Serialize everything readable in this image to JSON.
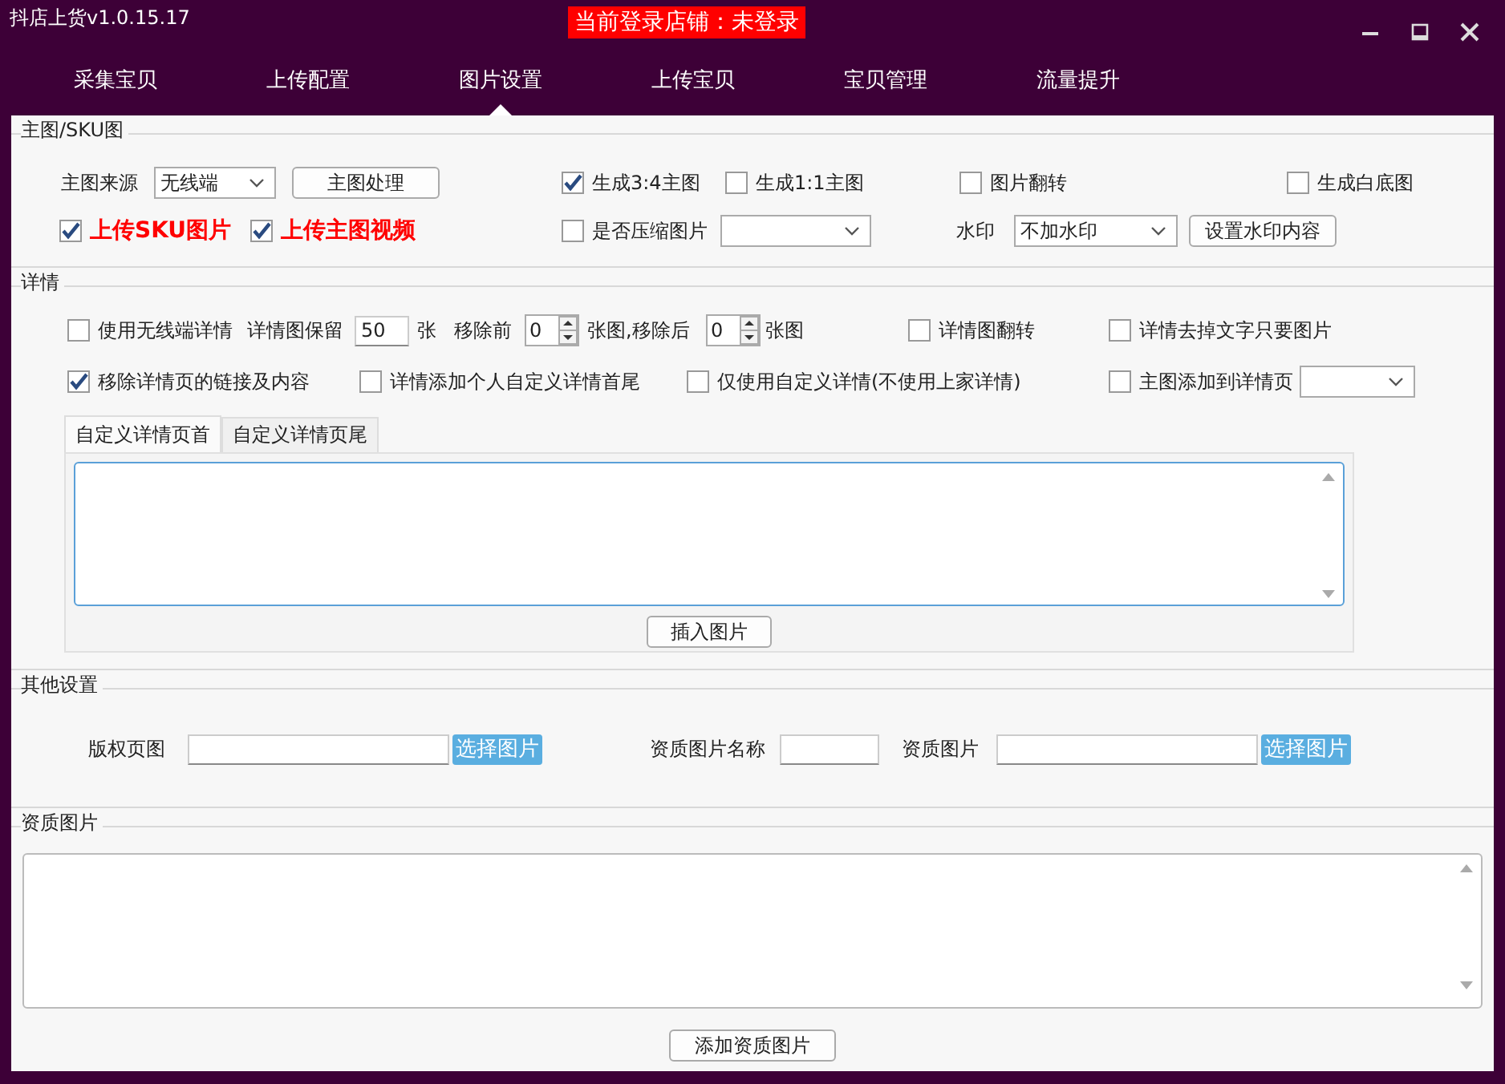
{
  "window": {
    "title": "抖店上货v1.0.15.17",
    "login_status": "当前登录店铺：未登录"
  },
  "tabs": [
    {
      "label": "采集宝贝",
      "selected": false
    },
    {
      "label": "上传配置",
      "selected": false
    },
    {
      "label": "图片设置",
      "selected": true
    },
    {
      "label": "上传宝贝",
      "selected": false
    },
    {
      "label": "宝贝管理",
      "selected": false
    },
    {
      "label": "流量提升",
      "selected": false
    }
  ],
  "main_image": {
    "title": "主图/SKU图",
    "source_label": "主图来源",
    "source_value": "无线端",
    "process_button": "主图处理",
    "gen_3_4": {
      "label": "生成3:4主图",
      "checked": true
    },
    "gen_1_1": {
      "label": "生成1:1主图",
      "checked": false
    },
    "flip": {
      "label": "图片翻转",
      "checked": false
    },
    "white_bg": {
      "label": "生成白底图",
      "checked": false
    },
    "upload_sku": {
      "label": "上传SKU图片",
      "checked": true
    },
    "upload_video": {
      "label": "上传主图视频",
      "checked": true
    },
    "compress": {
      "label": "是否压缩图片",
      "checked": false
    },
    "watermark_label": "水印",
    "watermark_value": "不加水印",
    "watermark_button": "设置水印内容"
  },
  "details": {
    "title": "详情",
    "use_wireless": {
      "label": "使用无线端详情",
      "checked": false
    },
    "keep_label": "详情图保留",
    "keep_value": "50",
    "keep_unit": "张",
    "remove_before_label": "移除前",
    "remove_before_value": "0",
    "remove_before_unit": "张图,移除后",
    "remove_after_value": "0",
    "remove_after_unit": "张图",
    "flip": {
      "label": "详情图翻转",
      "checked": false
    },
    "strip_text": {
      "label": "详情去掉文字只要图片",
      "checked": false
    },
    "remove_links": {
      "label": "移除详情页的链接及内容",
      "checked": true
    },
    "add_custom": {
      "label": "详情添加个人自定义详情首尾",
      "checked": false
    },
    "only_custom": {
      "label": "仅使用自定义详情(不使用上家详情)",
      "checked": false
    },
    "add_main": {
      "label": "主图添加到详情页",
      "checked": false
    },
    "editor_tabs": [
      {
        "label": "自定义详情页首",
        "selected": true
      },
      {
        "label": "自定义详情页尾",
        "selected": false
      }
    ],
    "insert_button": "插入图片"
  },
  "other": {
    "title": "其他设置",
    "copyright_label": "版权页图",
    "copyright_button": "选择图片",
    "cert_name_label": "资质图片名称",
    "cert_label": "资质图片",
    "cert_button": "选择图片"
  },
  "certificates": {
    "title": "资质图片",
    "add_button": "添加资质图片"
  }
}
